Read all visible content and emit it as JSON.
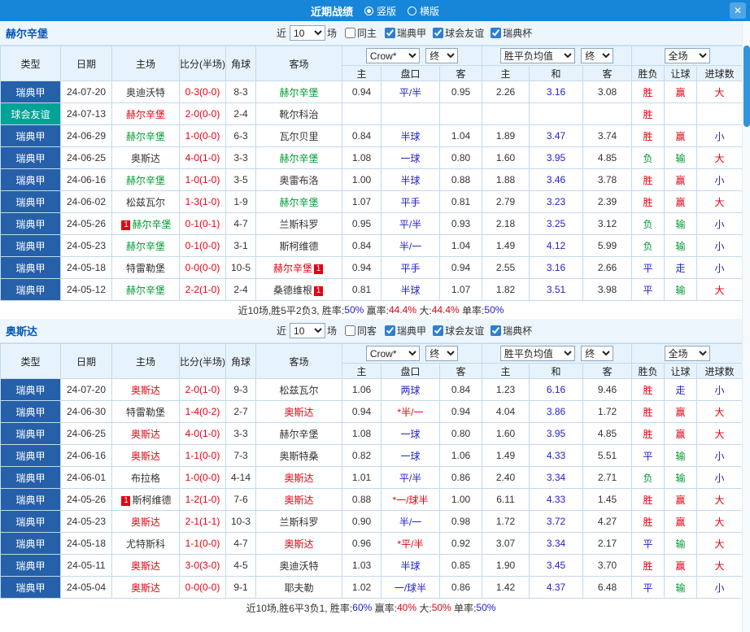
{
  "titlebar": {
    "title": "近期战绩",
    "radio_vertical": "竖版",
    "radio_horizontal": "横版",
    "close_label": "✕"
  },
  "controls": {
    "near_label": "近",
    "near_count": "10",
    "games_label": "场",
    "same_checked": false,
    "comps": [
      {
        "label": "瑞典甲",
        "checked": true
      },
      {
        "label": "球会友谊",
        "checked": true
      },
      {
        "label": "瑞典杯",
        "checked": true
      }
    ],
    "odds_company": "Crow*",
    "final_label": "终",
    "europe_avg": "胜平负均值",
    "scope": "全场"
  },
  "table_header": {
    "main_cols": [
      "类型",
      "日期",
      "主场",
      "比分(半场)",
      "角球",
      "客场"
    ],
    "asia_sub": [
      "主",
      "盘口",
      "客"
    ],
    "europe_sub": [
      "主",
      "和",
      "客"
    ],
    "result_sub": [
      "胜负",
      "让球",
      "进球数"
    ]
  },
  "colors": {
    "red": "#e60012",
    "green": "#009933",
    "blue": "#2222cc",
    "black": "#333333",
    "league_bg": "#2660a8",
    "friendly_bg": "#00a396",
    "topbar_bg": "#1786d9",
    "team_heading": "#0057b8"
  },
  "sections": [
    {
      "team": "赫尔辛堡",
      "same_label": "同主",
      "rows": [
        {
          "type": "瑞典甲",
          "tcls": "league",
          "date": "24-07-20",
          "home": "奥迪沃特",
          "hc": "k",
          "hb": "",
          "score": "0-3(0-0)",
          "corner": "8-3",
          "away": "赫尔辛堡",
          "ac": "g",
          "ab": "",
          "ah": [
            "0.94",
            "平/半",
            "0.95"
          ],
          "lc": "b",
          "eu": [
            "2.26",
            "3.16",
            "3.08"
          ],
          "res": [
            "胜",
            "赢",
            "大"
          ],
          "rc": [
            "r",
            "r",
            "r"
          ]
        },
        {
          "type": "球会友谊",
          "tcls": "friendly",
          "date": "24-07-13",
          "home": "赫尔辛堡",
          "hc": "r",
          "hb": "",
          "score": "2-0(0-0)",
          "corner": "2-4",
          "away": "靴尔科治",
          "ac": "k",
          "ab": "",
          "ah": [
            "",
            "",
            ""
          ],
          "lc": "b",
          "eu": [
            "",
            "",
            ""
          ],
          "res": [
            "胜",
            "",
            ""
          ],
          "rc": [
            "r",
            "",
            ""
          ]
        },
        {
          "type": "瑞典甲",
          "tcls": "league",
          "date": "24-06-29",
          "home": "赫尔辛堡",
          "hc": "g",
          "hb": "",
          "score": "1-0(0-0)",
          "corner": "6-3",
          "away": "瓦尔贝里",
          "ac": "k",
          "ab": "",
          "ah": [
            "0.84",
            "半球",
            "1.04"
          ],
          "lc": "b",
          "eu": [
            "1.89",
            "3.47",
            "3.74"
          ],
          "res": [
            "胜",
            "赢",
            "小"
          ],
          "rc": [
            "r",
            "r",
            "b"
          ]
        },
        {
          "type": "瑞典甲",
          "tcls": "league",
          "date": "24-06-25",
          "home": "奥斯达",
          "hc": "k",
          "hb": "",
          "score": "4-0(1-0)",
          "corner": "3-3",
          "away": "赫尔辛堡",
          "ac": "g",
          "ab": "",
          "ah": [
            "1.08",
            "一球",
            "0.80"
          ],
          "lc": "b",
          "eu": [
            "1.60",
            "3.95",
            "4.85"
          ],
          "res": [
            "负",
            "输",
            "大"
          ],
          "rc": [
            "g",
            "g",
            "r"
          ]
        },
        {
          "type": "瑞典甲",
          "tcls": "league",
          "date": "24-06-16",
          "home": "赫尔辛堡",
          "hc": "g",
          "hb": "",
          "score": "1-0(1-0)",
          "corner": "3-5",
          "away": "奥雷布洛",
          "ac": "k",
          "ab": "",
          "ah": [
            "1.00",
            "半球",
            "0.88"
          ],
          "lc": "b",
          "eu": [
            "1.88",
            "3.46",
            "3.78"
          ],
          "res": [
            "胜",
            "赢",
            "小"
          ],
          "rc": [
            "r",
            "r",
            "b"
          ]
        },
        {
          "type": "瑞典甲",
          "tcls": "league",
          "date": "24-06-02",
          "home": "松兹瓦尔",
          "hc": "k",
          "hb": "",
          "score": "1-3(1-0)",
          "corner": "1-9",
          "away": "赫尔辛堡",
          "ac": "g",
          "ab": "",
          "ah": [
            "1.07",
            "平手",
            "0.81"
          ],
          "lc": "b",
          "eu": [
            "2.79",
            "3.23",
            "2.39"
          ],
          "res": [
            "胜",
            "赢",
            "大"
          ],
          "rc": [
            "r",
            "r",
            "r"
          ]
        },
        {
          "type": "瑞典甲",
          "tcls": "league",
          "date": "24-05-26",
          "home": "赫尔辛堡",
          "hc": "g",
          "hb": "1",
          "score": "0-1(0-1)",
          "corner": "4-7",
          "away": "兰斯科罗",
          "ac": "k",
          "ab": "",
          "ah": [
            "0.95",
            "平/半",
            "0.93"
          ],
          "lc": "b",
          "eu": [
            "2.18",
            "3.25",
            "3.12"
          ],
          "res": [
            "负",
            "输",
            "小"
          ],
          "rc": [
            "g",
            "g",
            "b"
          ]
        },
        {
          "type": "瑞典甲",
          "tcls": "league",
          "date": "24-05-23",
          "home": "赫尔辛堡",
          "hc": "g",
          "hb": "",
          "score": "0-1(0-0)",
          "corner": "3-1",
          "away": "斯柯维德",
          "ac": "k",
          "ab": "",
          "ah": [
            "0.84",
            "半/一",
            "1.04"
          ],
          "lc": "b",
          "eu": [
            "1.49",
            "4.12",
            "5.99"
          ],
          "res": [
            "负",
            "输",
            "小"
          ],
          "rc": [
            "g",
            "g",
            "b"
          ]
        },
        {
          "type": "瑞典甲",
          "tcls": "league",
          "date": "24-05-18",
          "home": "特雷勒堡",
          "hc": "k",
          "hb": "",
          "score": "0-0(0-0)",
          "corner": "10-5",
          "away": "赫尔辛堡",
          "ac": "r",
          "ab": "1",
          "ah": [
            "0.94",
            "平手",
            "0.94"
          ],
          "lc": "b",
          "eu": [
            "2.55",
            "3.16",
            "2.66"
          ],
          "res": [
            "平",
            "走",
            "小"
          ],
          "rc": [
            "b",
            "b",
            "b"
          ]
        },
        {
          "type": "瑞典甲",
          "tcls": "league",
          "date": "24-05-12",
          "home": "赫尔辛堡",
          "hc": "g",
          "hb": "",
          "score": "2-2(1-0)",
          "corner": "2-4",
          "away": "桑德维根",
          "ac": "k",
          "ab": "1",
          "ah": [
            "0.81",
            "半球",
            "1.07"
          ],
          "lc": "b",
          "eu": [
            "1.82",
            "3.51",
            "3.98"
          ],
          "res": [
            "平",
            "输",
            "大"
          ],
          "rc": [
            "b",
            "g",
            "r"
          ]
        }
      ],
      "summary": [
        {
          "t": "近10场,胜5平2负3, 胜率:",
          "c": "k"
        },
        {
          "t": "50%",
          "c": "b"
        },
        {
          "t": " 赢率:",
          "c": "k"
        },
        {
          "t": "44.4%",
          "c": "r"
        },
        {
          "t": " 大:",
          "c": "k"
        },
        {
          "t": "44.4%",
          "c": "r"
        },
        {
          "t": " 单率:",
          "c": "k"
        },
        {
          "t": "50%",
          "c": "b"
        }
      ]
    },
    {
      "team": "奥斯达",
      "same_label": "同客",
      "rows": [
        {
          "type": "瑞典甲",
          "tcls": "league",
          "date": "24-07-20",
          "home": "奥斯达",
          "hc": "r",
          "hb": "",
          "score": "2-0(1-0)",
          "corner": "9-3",
          "away": "松兹瓦尔",
          "ac": "k",
          "ab": "",
          "ah": [
            "1.06",
            "两球",
            "0.84"
          ],
          "lc": "b",
          "eu": [
            "1.23",
            "6.16",
            "9.46"
          ],
          "res": [
            "胜",
            "走",
            "小"
          ],
          "rc": [
            "r",
            "b",
            "b"
          ]
        },
        {
          "type": "瑞典甲",
          "tcls": "league",
          "date": "24-06-30",
          "home": "特雷勒堡",
          "hc": "k",
          "hb": "",
          "score": "1-4(0-2)",
          "corner": "2-7",
          "away": "奥斯达",
          "ac": "r",
          "ab": "",
          "ah": [
            "0.94",
            "*半/一",
            "0.94"
          ],
          "lc": "r",
          "eu": [
            "4.04",
            "3.86",
            "1.72"
          ],
          "res": [
            "胜",
            "赢",
            "大"
          ],
          "rc": [
            "r",
            "r",
            "r"
          ]
        },
        {
          "type": "瑞典甲",
          "tcls": "league",
          "date": "24-06-25",
          "home": "奥斯达",
          "hc": "r",
          "hb": "",
          "score": "4-0(1-0)",
          "corner": "3-3",
          "away": "赫尔辛堡",
          "ac": "k",
          "ab": "",
          "ah": [
            "1.08",
            "一球",
            "0.80"
          ],
          "lc": "b",
          "eu": [
            "1.60",
            "3.95",
            "4.85"
          ],
          "res": [
            "胜",
            "赢",
            "大"
          ],
          "rc": [
            "r",
            "r",
            "r"
          ]
        },
        {
          "type": "瑞典甲",
          "tcls": "league",
          "date": "24-06-16",
          "home": "奥斯达",
          "hc": "r",
          "hb": "",
          "score": "1-1(0-0)",
          "corner": "7-3",
          "away": "奥斯特桑",
          "ac": "k",
          "ab": "",
          "ah": [
            "0.82",
            "一球",
            "1.06"
          ],
          "lc": "b",
          "eu": [
            "1.49",
            "4.33",
            "5.51"
          ],
          "res": [
            "平",
            "输",
            "小"
          ],
          "rc": [
            "b",
            "g",
            "b"
          ]
        },
        {
          "type": "瑞典甲",
          "tcls": "league",
          "date": "24-06-01",
          "home": "布拉格",
          "hc": "k",
          "hb": "",
          "score": "1-0(0-0)",
          "corner": "4-14",
          "away": "奥斯达",
          "ac": "r",
          "ab": "",
          "ah": [
            "1.01",
            "平/半",
            "0.86"
          ],
          "lc": "b",
          "eu": [
            "2.40",
            "3.34",
            "2.71"
          ],
          "res": [
            "负",
            "输",
            "小"
          ],
          "rc": [
            "g",
            "g",
            "b"
          ]
        },
        {
          "type": "瑞典甲",
          "tcls": "league",
          "date": "24-05-26",
          "home": "斯柯维德",
          "hc": "k",
          "hb": "1",
          "score": "1-2(1-0)",
          "corner": "7-6",
          "away": "奥斯达",
          "ac": "r",
          "ab": "",
          "ah": [
            "0.88",
            "*一/球半",
            "1.00"
          ],
          "lc": "r",
          "eu": [
            "6.11",
            "4.33",
            "1.45"
          ],
          "res": [
            "胜",
            "赢",
            "大"
          ],
          "rc": [
            "r",
            "r",
            "r"
          ]
        },
        {
          "type": "瑞典甲",
          "tcls": "league",
          "date": "24-05-23",
          "home": "奥斯达",
          "hc": "r",
          "hb": "",
          "score": "2-1(1-1)",
          "corner": "10-3",
          "away": "兰斯科罗",
          "ac": "k",
          "ab": "",
          "ah": [
            "0.90",
            "半/一",
            "0.98"
          ],
          "lc": "b",
          "eu": [
            "1.72",
            "3.72",
            "4.27"
          ],
          "res": [
            "胜",
            "赢",
            "大"
          ],
          "rc": [
            "r",
            "r",
            "r"
          ]
        },
        {
          "type": "瑞典甲",
          "tcls": "league",
          "date": "24-05-18",
          "home": "尤特斯科",
          "hc": "k",
          "hb": "",
          "score": "1-1(0-0)",
          "corner": "4-7",
          "away": "奥斯达",
          "ac": "r",
          "ab": "",
          "ah": [
            "0.96",
            "*平/半",
            "0.92"
          ],
          "lc": "r",
          "eu": [
            "3.07",
            "3.34",
            "2.17"
          ],
          "res": [
            "平",
            "输",
            "大"
          ],
          "rc": [
            "b",
            "g",
            "r"
          ]
        },
        {
          "type": "瑞典甲",
          "tcls": "league",
          "date": "24-05-11",
          "home": "奥斯达",
          "hc": "r",
          "hb": "",
          "score": "3-0(3-0)",
          "corner": "4-5",
          "away": "奥迪沃特",
          "ac": "k",
          "ab": "",
          "ah": [
            "1.03",
            "半球",
            "0.85"
          ],
          "lc": "b",
          "eu": [
            "1.90",
            "3.45",
            "3.70"
          ],
          "res": [
            "胜",
            "赢",
            "大"
          ],
          "rc": [
            "r",
            "r",
            "r"
          ]
        },
        {
          "type": "瑞典甲",
          "tcls": "league",
          "date": "24-05-04",
          "home": "奥斯达",
          "hc": "r",
          "hb": "",
          "score": "0-0(0-0)",
          "corner": "9-1",
          "away": "耶夫勒",
          "ac": "k",
          "ab": "",
          "ah": [
            "1.02",
            "一/球半",
            "0.86"
          ],
          "lc": "b",
          "eu": [
            "1.42",
            "4.37",
            "6.48"
          ],
          "res": [
            "平",
            "输",
            "小"
          ],
          "rc": [
            "b",
            "g",
            "b"
          ]
        }
      ],
      "summary": [
        {
          "t": "近10场,胜6平3负1, 胜率:",
          "c": "k"
        },
        {
          "t": "60%",
          "c": "b"
        },
        {
          "t": " 赢率:",
          "c": "k"
        },
        {
          "t": "40%",
          "c": "r"
        },
        {
          "t": " 大:",
          "c": "k"
        },
        {
          "t": "50%",
          "c": "r"
        },
        {
          "t": " 单率:",
          "c": "k"
        },
        {
          "t": "50%",
          "c": "b"
        }
      ]
    }
  ]
}
